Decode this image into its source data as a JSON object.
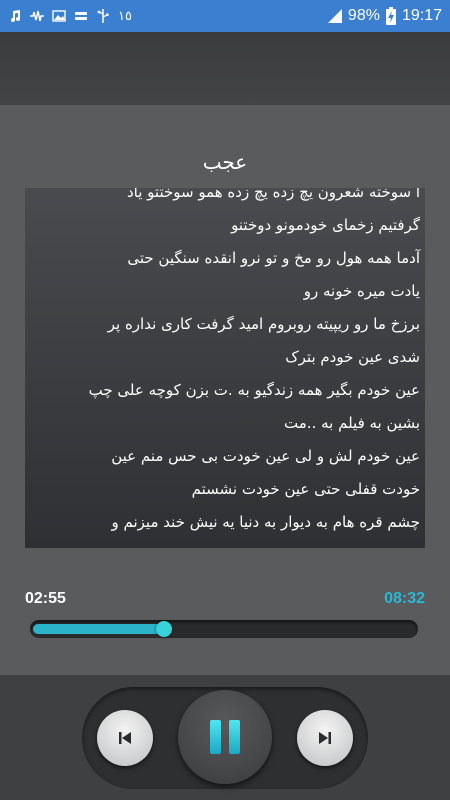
{
  "status_bar": {
    "notif_count": "١٥",
    "battery": "98%",
    "time": "19:17",
    "left_icons": [
      "music-note-icon",
      "waveform-icon",
      "image-icon",
      "sync-icon",
      "usb-icon"
    ],
    "right_icons": [
      "signal-icon",
      "charging-battery-icon"
    ]
  },
  "song": {
    "title": "عجب"
  },
  "lyrics": [
    "ا سوخته شعرون یچ زده یچ زده همو سوختتو یاد",
    "گرفتیم زخمای خودمونو دوختنو",
    "آدما همه هول رو مخ و تو نرو انقده سنگین حتی",
    "یادت میره خونه رو",
    "برزخ ما رو ریپیته روبروم امید گرفت کاری نداره پر",
    "شدی عین خودم بترک",
    "عین خودم بگیر همه زندگیو به .ت بزن کوچه علی چپ",
    "بشین به فیلم به ..مت",
    "عین خودم لش و لی عین خودت بی حس منم عین",
    "خودت قفلی حتی عین خودت نشستم",
    "چشم قره هام به دیوار به دنیا یه نیش خند میزنم و"
  ],
  "player": {
    "current_time": "02:55",
    "total_time": "08:32",
    "progress": 0.342,
    "accent_color": "#2bb3c9",
    "controls": [
      "previous-icon",
      "pause-icon",
      "next-icon"
    ]
  }
}
